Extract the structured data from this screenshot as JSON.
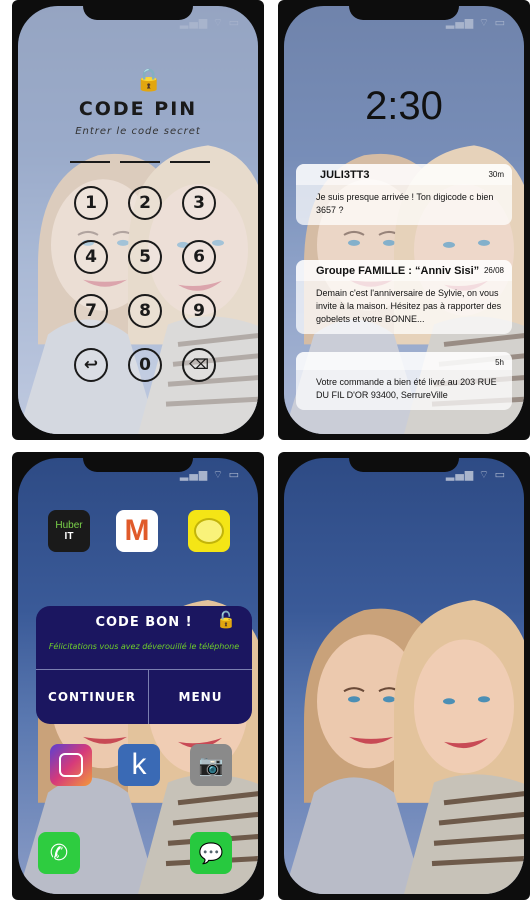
{
  "status_icons": "▂▄▆ ⌔ ▭",
  "pin_screen": {
    "title": "CODE PIN",
    "subtitle": "Entrer le code secret",
    "keys": [
      "1",
      "2",
      "3",
      "4",
      "5",
      "6",
      "7",
      "8",
      "9",
      "↩",
      "0",
      "⌫"
    ]
  },
  "lock_screen": {
    "time": "2:30",
    "notifications": [
      {
        "sender": "JULI3TT3",
        "time": "30m",
        "body": "Je suis presque arrivée ! Ton digicode c bien 3657 ?"
      },
      {
        "sender": "Groupe FAMILLE : “Anniv Sisi”",
        "time": "26/08",
        "body": "Demain c'est l'anniversaire de Sylvie, on vous invite à la maison. Hésitez pas à rapporter des gobelets  et votre BONNE..."
      },
      {
        "sender": "",
        "time": "5h",
        "body": "Votre commande a bien été livré au 203 RUE DU FIL D'OR 93400, SerrureVille"
      }
    ]
  },
  "home_screen": {
    "apps": {
      "huber_line1": "Huber",
      "huber_line2": "IT",
      "mail_letter": "M",
      "kapp_letter": "k"
    },
    "dialog": {
      "title": "CODE BON !",
      "message": "Félicitations vous avez déverouillé le téléphone",
      "continue": "CONTINUER",
      "menu": "MENU"
    }
  },
  "colors": {
    "screen_bg": "#2e4b85",
    "dialog_bg": "#1b1660",
    "dialog_msg": "#6fcf2a",
    "phone_app": "#2ecc40",
    "messages_app": "#27c93f"
  }
}
